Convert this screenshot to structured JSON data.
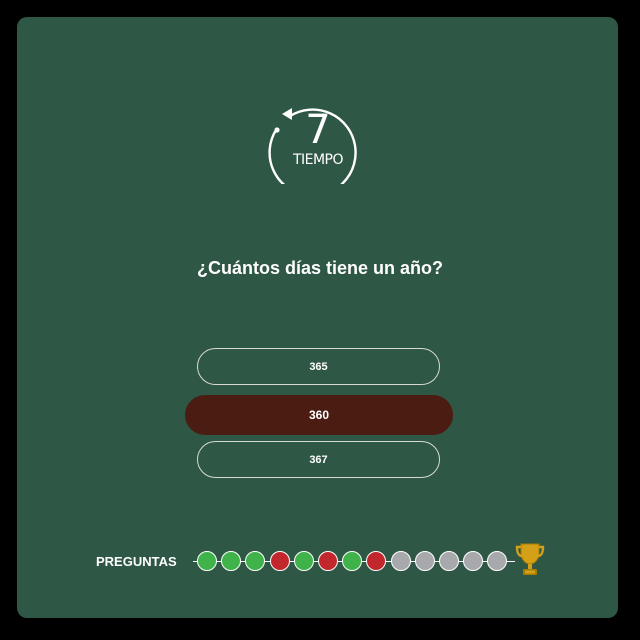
{
  "timer": {
    "value": "7",
    "label": "TIEMPO",
    "icon": "countdown-circle-arrow-icon"
  },
  "question": {
    "text": "¿Cuántos días tiene un año?"
  },
  "answers": [
    {
      "label": "365",
      "state": "default"
    },
    {
      "label": "360",
      "state": "selected"
    },
    {
      "label": "367",
      "state": "default"
    }
  ],
  "progress": {
    "label": "PREGUNTAS",
    "questions": [
      "correct",
      "correct",
      "correct",
      "wrong",
      "correct",
      "wrong",
      "correct",
      "wrong",
      "pending",
      "pending",
      "pending",
      "pending",
      "pending"
    ],
    "trophy_icon": "trophy-icon"
  },
  "colors": {
    "background": "#000000",
    "panel": "#2f5746",
    "selected_answer": "#4a1c12",
    "correct": "#3fb34a",
    "wrong": "#c1272d",
    "pending": "#a7a9ac",
    "trophy": "#d4a017"
  }
}
